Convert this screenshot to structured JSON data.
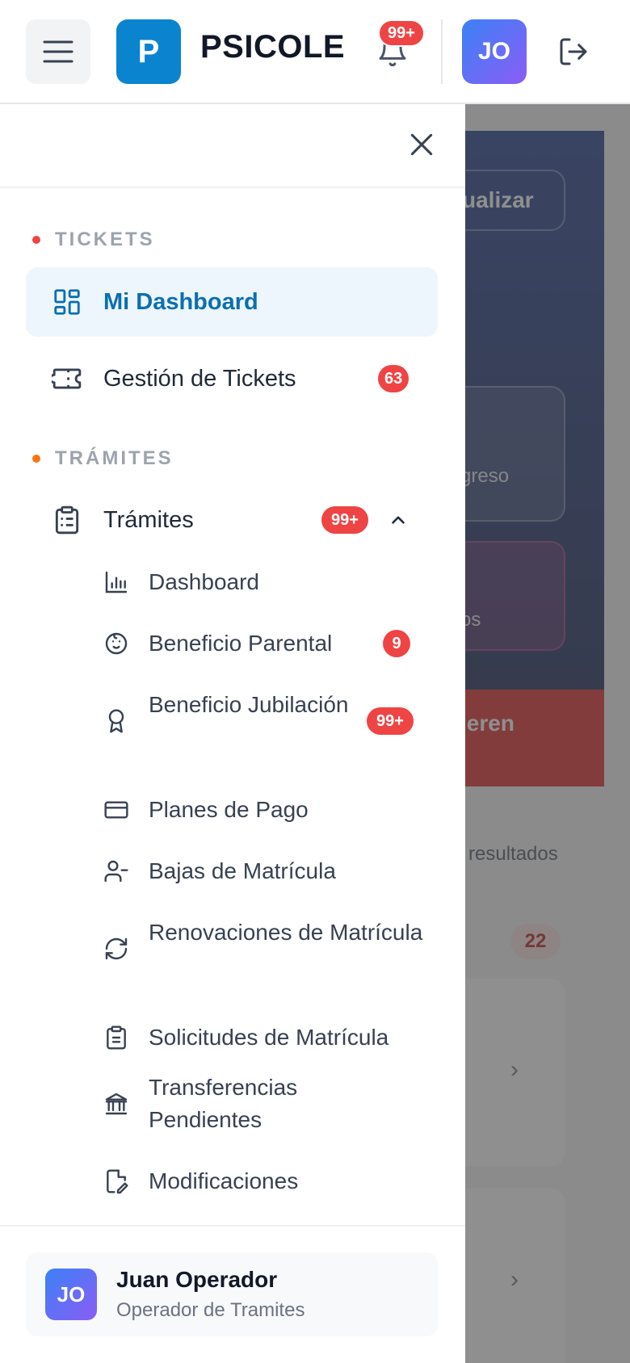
{
  "header": {
    "brand_initial": "P",
    "brand_name": "PSICOLE",
    "notifications_badge": "99+",
    "user_initials": "JO"
  },
  "background": {
    "update_button": "ualizar",
    "card1_text": "greso",
    "card2_text": "os",
    "alert_text": "ieren",
    "results_text": "resultados",
    "count_badge": "22"
  },
  "sidebar": {
    "sections": [
      {
        "label": "TICKETS",
        "dot_color": "#ef4444"
      },
      {
        "label": "TRÁMITES",
        "dot_color": "#f97316"
      }
    ],
    "items": [
      {
        "label": "Mi Dashboard",
        "icon": "dashboard-icon",
        "active": true
      },
      {
        "label": "Gestión de Tickets",
        "icon": "ticket-icon",
        "badge": "63"
      },
      {
        "label": "Trámites",
        "icon": "clipboard-list-icon",
        "badge": "99+",
        "expanded": true
      }
    ],
    "subitems": [
      {
        "label": "Dashboard",
        "icon": "bar-chart-icon"
      },
      {
        "label": "Beneficio Parental",
        "icon": "baby-icon",
        "badge": "9"
      },
      {
        "label": "Beneficio Jubilación",
        "icon": "award-icon",
        "badge": "99+"
      },
      {
        "label": "Planes de Pago",
        "icon": "credit-card-icon"
      },
      {
        "label": "Bajas de Matrícula",
        "icon": "user-minus-icon"
      },
      {
        "label": "Renovaciones de Matrícula",
        "icon": "refresh-icon"
      },
      {
        "label": "Solicitudes de Matrícula",
        "icon": "clipboard-icon"
      },
      {
        "label": "Transferencias Pendientes",
        "icon": "bank-icon"
      },
      {
        "label": "Modificaciones",
        "icon": "file-edit-icon"
      }
    ]
  },
  "user": {
    "initials": "JO",
    "name": "Juan Operador",
    "role": "Operador de Tramites"
  },
  "colors": {
    "brand": "#0a84cf",
    "badge": "#ef4444",
    "active_bg": "#eef6fd",
    "active_text": "#0a6fb0"
  }
}
